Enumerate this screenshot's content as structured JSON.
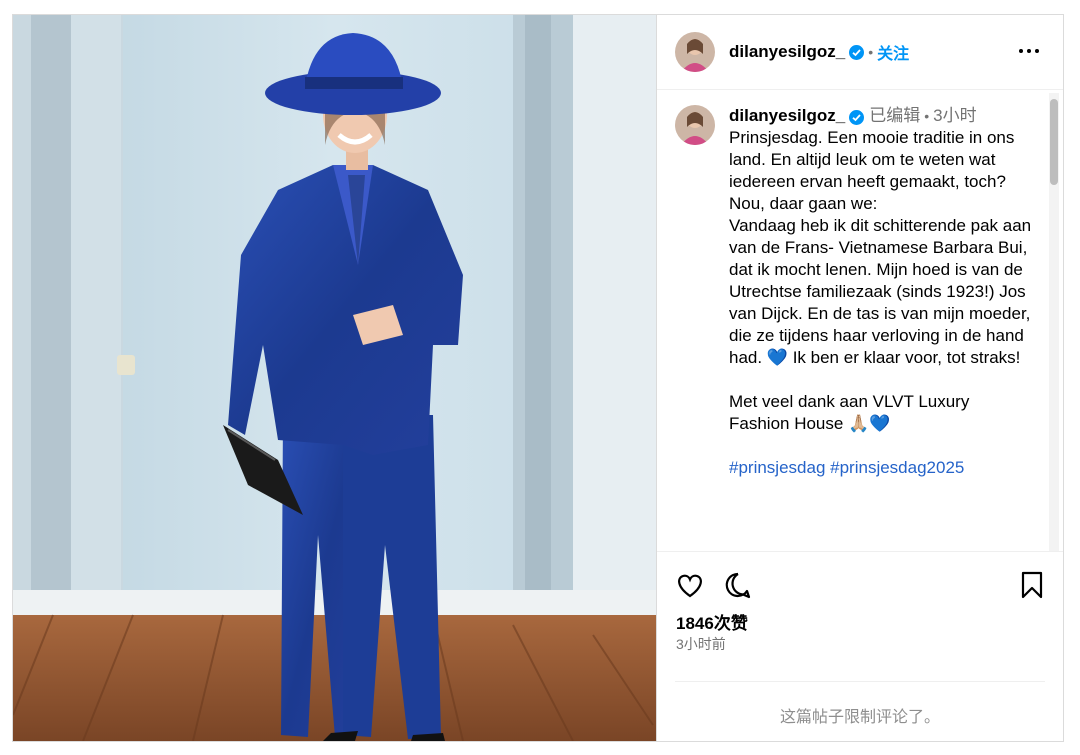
{
  "post": {
    "username": "dilanyesilgoz_",
    "follow_label": "关注",
    "separator_dot": "•",
    "caption": {
      "edited_label": "已编辑",
      "time": "3小时",
      "paragraph1": "Prinsjesdag. Een mooie traditie in ons land. En altijd leuk om te weten wat iedereen ervan heeft gemaakt, toch? Nou, daar gaan we:\nVandaag heb ik dit schitterende pak aan van de Frans- Vietnamese Barbara Bui, dat ik mocht lenen. Mijn hoed is van de Utrechtse familiezaak (sinds 1923!) Jos van Dijck. En de tas is van mijn moeder, die ze tijdens haar verloving in de hand had. 💙 Ik ben er klaar voor, tot straks!",
      "paragraph2": "Met veel dank aan VLVT Luxury Fashion House 🙏🏼💙",
      "hashtags": [
        "#prinsjesdag",
        "#prinsjesdag2025"
      ]
    },
    "likes_label": "1846次赞",
    "posted_ago": "3小时前",
    "comments_limited_label": "这篇帖子限制评论了。"
  },
  "icons": {
    "verified": "verified-badge-icon",
    "more": "more-options-icon",
    "like": "heart-icon",
    "comment": "comment-icon",
    "save": "bookmark-icon"
  },
  "colors": {
    "link_blue": "#0095f6",
    "hashtag_blue": "#2563c9",
    "muted_gray": "#737373",
    "suit_blue": "#1f3f9a",
    "border": "#dbdbdb"
  }
}
